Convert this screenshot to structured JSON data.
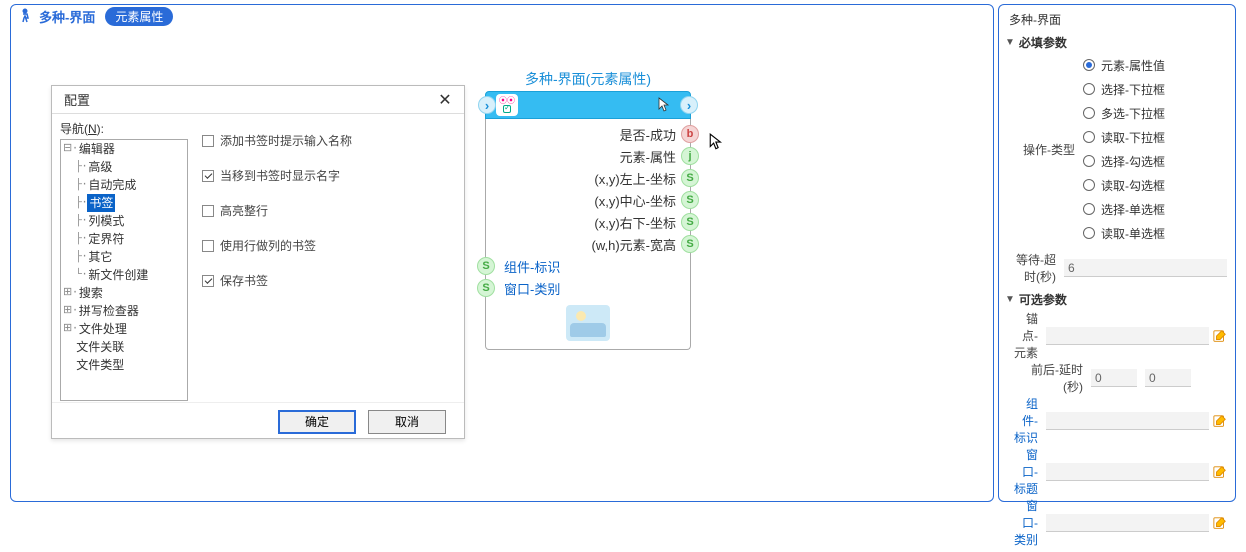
{
  "header": {
    "title": "多种-界面",
    "pill": "元素属性"
  },
  "dialog": {
    "title": "配置",
    "nav_label_pre": "导航(",
    "nav_label_u": "N",
    "nav_label_post": "):",
    "tree": [
      {
        "pre": "⊟·",
        "label": "编辑器"
      },
      {
        "pre": "  ├·",
        "label": "高级"
      },
      {
        "pre": "  ├·",
        "label": "自动完成"
      },
      {
        "pre": "  ├·",
        "label": "书签",
        "selected": true
      },
      {
        "pre": "  ├·",
        "label": "列模式"
      },
      {
        "pre": "  ├·",
        "label": "定界符"
      },
      {
        "pre": "  ├·",
        "label": "其它"
      },
      {
        "pre": "  └·",
        "label": "新文件创建"
      },
      {
        "pre": "⊞·",
        "label": "搜索"
      },
      {
        "pre": "⊞·",
        "label": "拼写检查器"
      },
      {
        "pre": "⊞·",
        "label": "文件处理"
      },
      {
        "pre": "  ",
        "label": "文件关联"
      },
      {
        "pre": "  ",
        "label": "文件类型"
      }
    ],
    "checks": [
      {
        "label": "添加书签时提示输入名称",
        "checked": false
      },
      {
        "label": "当移到书签时显示名字",
        "checked": true
      },
      {
        "label": "高亮整行",
        "checked": false
      },
      {
        "label": "使用行做列的书签",
        "checked": false
      },
      {
        "label": "保存书签",
        "checked": true
      }
    ],
    "ok": "确定",
    "cancel": "取消"
  },
  "block": {
    "title": "多种-界面(元素属性)",
    "rows_right": [
      {
        "label": "是否-成功",
        "port": "b"
      },
      {
        "label": "元素-属性",
        "port": "j"
      },
      {
        "label": "(x,y)左上-坐标",
        "port": "s"
      },
      {
        "label": "(x,y)中心-坐标",
        "port": "s"
      },
      {
        "label": "(x,y)右下-坐标",
        "port": "s"
      },
      {
        "label": "(w,h)元素-宽高",
        "port": "s"
      }
    ],
    "rows_left": [
      {
        "label": "组件-标识",
        "port": "s"
      },
      {
        "label": "窗口-类别",
        "port": "s"
      }
    ]
  },
  "right": {
    "title": "多种-界面",
    "sect1": "必填参数",
    "op_label": "操作-类型",
    "radios": [
      {
        "label": "元素-属性值",
        "on": true
      },
      {
        "label": "选择-下拉框",
        "on": false
      },
      {
        "label": "多选-下拉框",
        "on": false
      },
      {
        "label": "读取-下拉框",
        "on": false
      },
      {
        "label": "选择-勾选框",
        "on": false
      },
      {
        "label": "读取-勾选框",
        "on": false
      },
      {
        "label": "选择-单选框",
        "on": false
      },
      {
        "label": "读取-单选框",
        "on": false
      }
    ],
    "wait_label": "等待-超时(秒)",
    "wait_value": "6",
    "sect2": "可选参数",
    "anchor_label": "锚点-元素",
    "delay_label": "前后-延时(秒)",
    "delay_v1": "0",
    "delay_v2": "0",
    "link_rows": [
      {
        "label": "组件-标识"
      },
      {
        "label": "窗口-标题"
      },
      {
        "label": "窗口-类别"
      }
    ]
  }
}
